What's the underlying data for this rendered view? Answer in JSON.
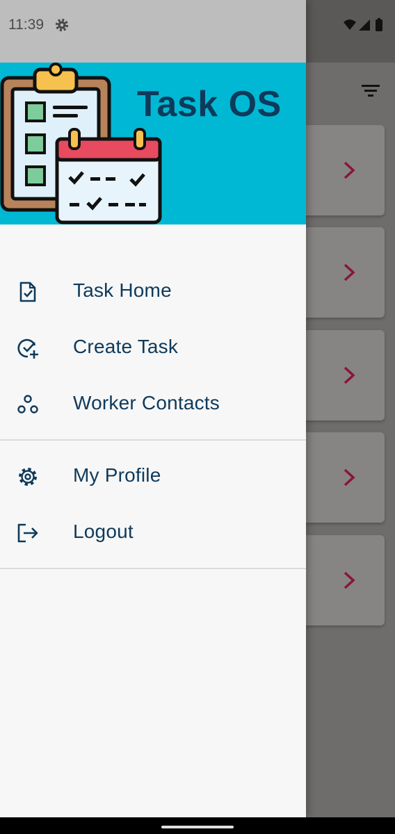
{
  "status_bar": {
    "time": "11:39",
    "settings_icon": "gear-icon",
    "wifi_icon": "wifi-icon",
    "signal_icon": "signal-icon",
    "battery_icon": "battery-icon"
  },
  "header": {
    "title": "Task OS",
    "logo_icon": "clipboard-calendar-icon"
  },
  "menu": {
    "primary": [
      {
        "label": "Task Home",
        "icon": "task-file-icon"
      },
      {
        "label": "Create Task",
        "icon": "check-circle-add-icon"
      },
      {
        "label": "Worker Contacts",
        "icon": "people-circles-icon"
      }
    ],
    "secondary": [
      {
        "label": "My Profile",
        "icon": "gear-icon"
      },
      {
        "label": "Logout",
        "icon": "logout-icon"
      }
    ]
  },
  "background": {
    "filter_icon": "filter-icon",
    "card_count": 5,
    "card_chevron": "chevron-right-icon"
  },
  "colors": {
    "header_bg": "#00b8d4",
    "brand_text": "#0e3a5b",
    "chevron": "#8a1538"
  }
}
